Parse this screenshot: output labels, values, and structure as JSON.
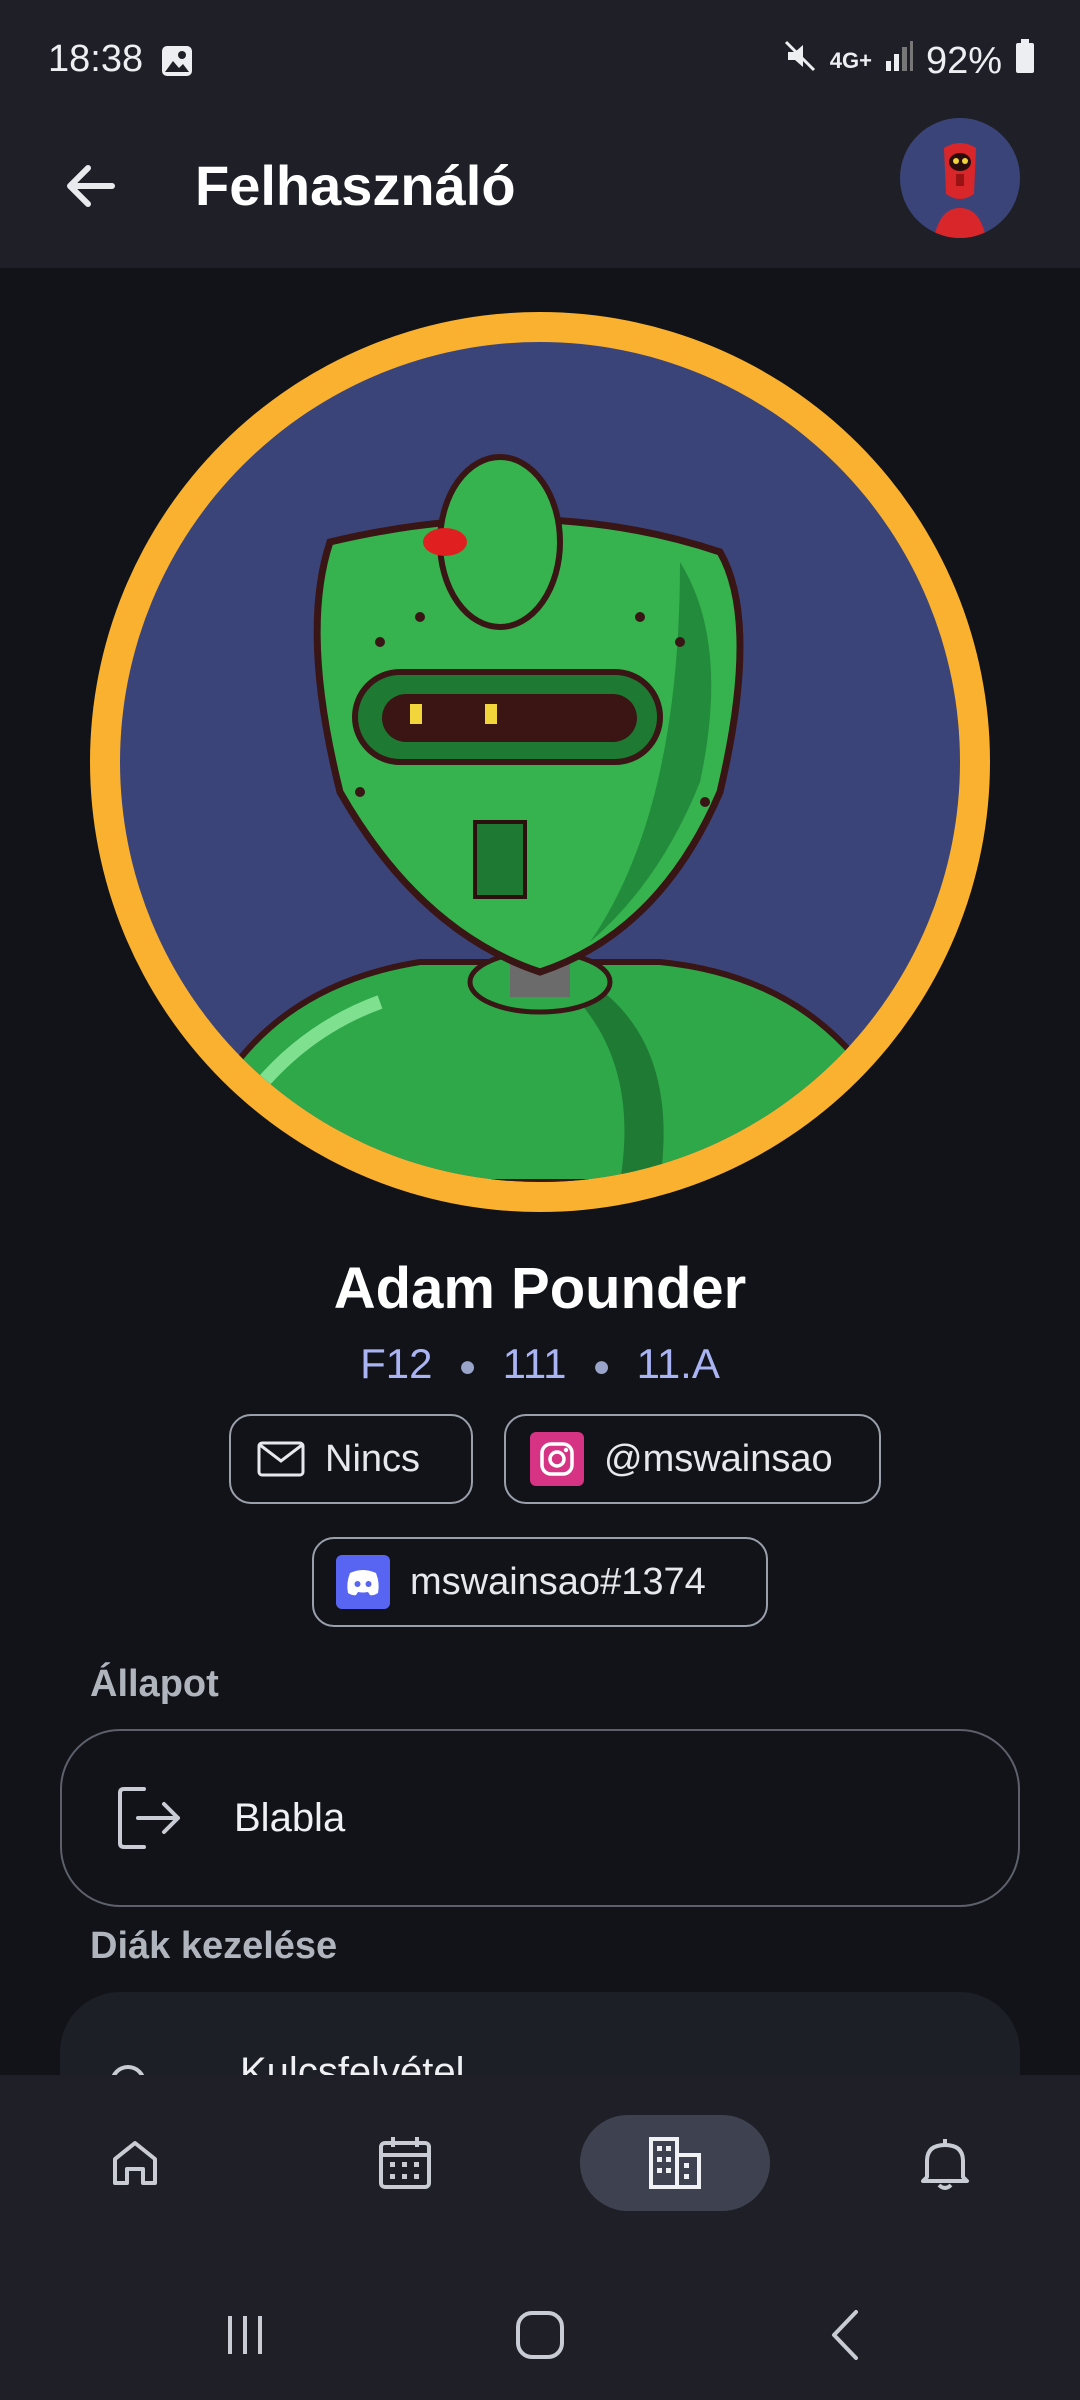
{
  "status_bar": {
    "time": "18:38",
    "network": "4G+",
    "battery": "92%"
  },
  "app_bar": {
    "title": "Felhasználó"
  },
  "profile": {
    "name": "Adam Pounder",
    "meta": [
      "F12",
      "111",
      "11.A"
    ],
    "email": "Nincs",
    "instagram": "@mswainsao",
    "discord": "mswainsao#1374"
  },
  "sections": {
    "status": {
      "heading": "Állapot",
      "value": "Blabla"
    },
    "manage": {
      "heading": "Diák kezelése",
      "item": "Kulcsfelvétel"
    }
  },
  "colors": {
    "accent_ring": "#f9b12f",
    "meta_text": "#aab4f4",
    "instagram": "#d63384",
    "discord": "#5865f2"
  },
  "icons": {
    "back": "arrow-left-icon",
    "email": "mail-icon",
    "instagram": "instagram-icon",
    "discord": "discord-icon",
    "status": "logout-icon",
    "manage": "key-icon",
    "nav": [
      "home-icon",
      "calendar-icon",
      "building-icon",
      "bell-icon"
    ]
  },
  "bottom_nav": {
    "active_index": 2
  }
}
